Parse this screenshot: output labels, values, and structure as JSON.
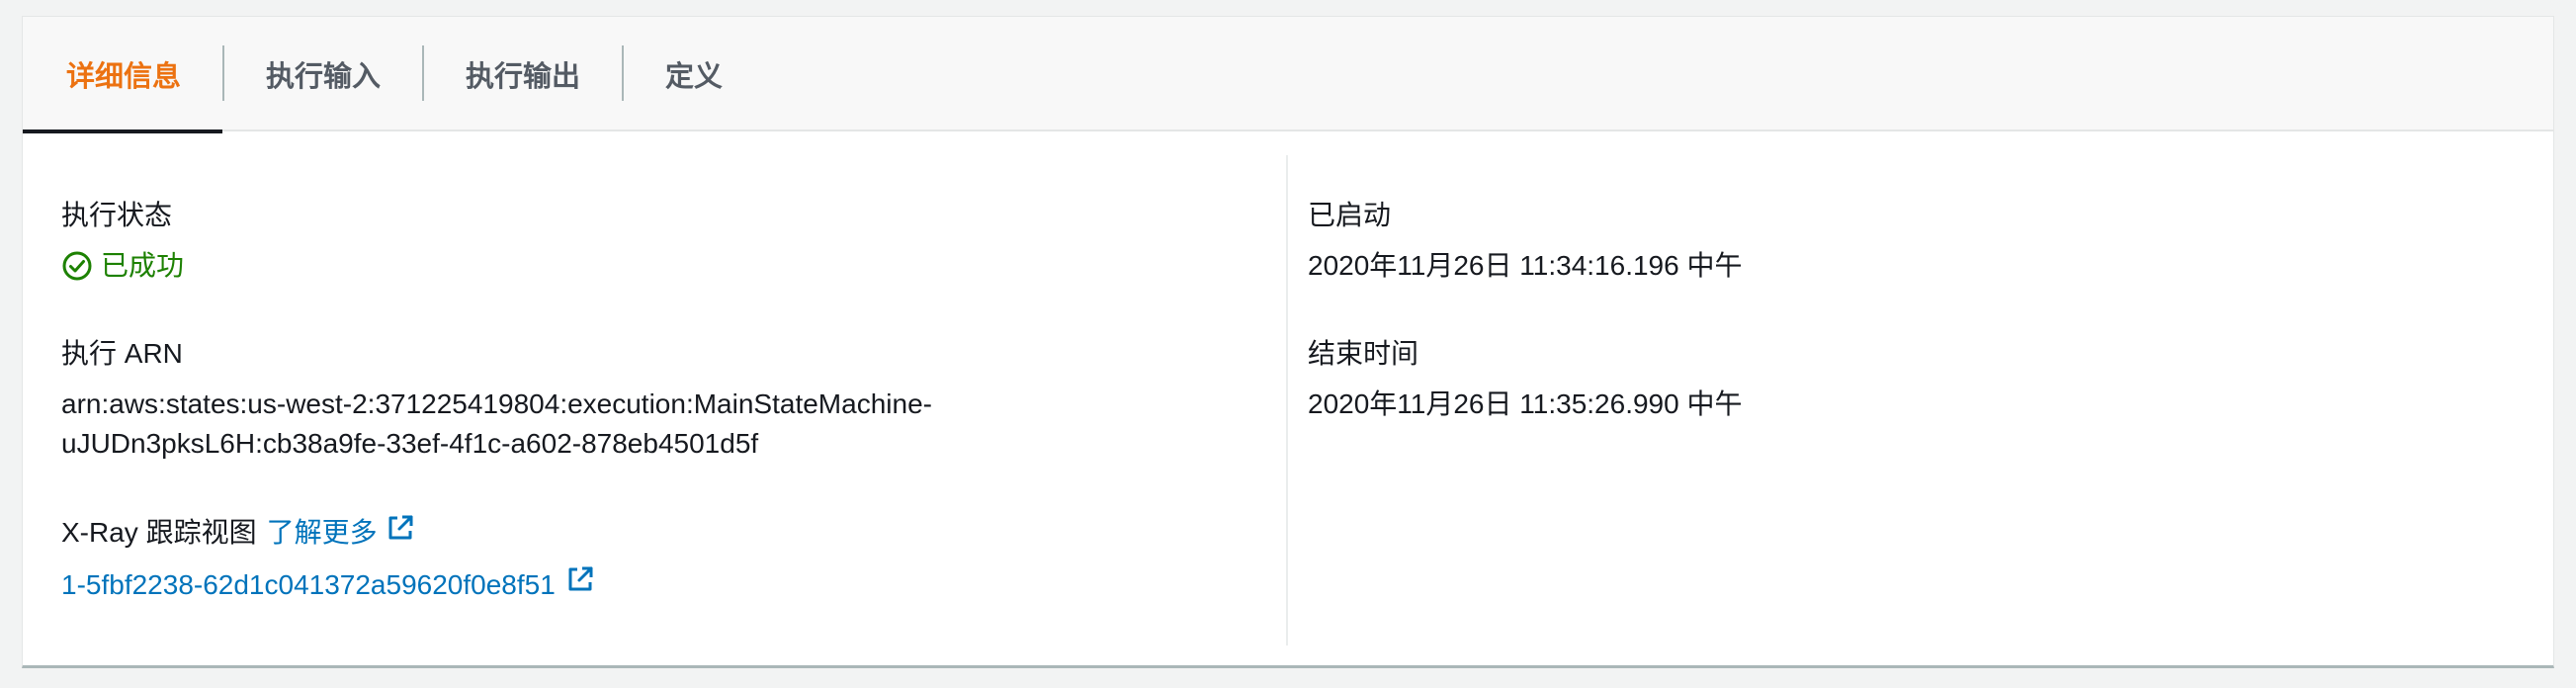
{
  "tabs": [
    {
      "label": "详细信息",
      "active": true
    },
    {
      "label": "执行输入",
      "active": false
    },
    {
      "label": "执行输出",
      "active": false
    },
    {
      "label": "定义",
      "active": false
    }
  ],
  "details": {
    "status": {
      "label": "执行状态",
      "value": "已成功",
      "icon": "check-circle-icon"
    },
    "arn": {
      "label": "执行 ARN",
      "line1": "arn:aws:states:us-west-2:371225419804:execution:MainStateMachine-",
      "line2": "uJUDn3pksL6H:cb38a9fe-33ef-4f1c-a602-878eb4501d5f"
    },
    "xray": {
      "label": "X-Ray 跟踪视图",
      "learn_more": "了解更多",
      "trace_id": "1-5fbf2238-62d1c041372a59620f0e8f51",
      "icon": "external-link-icon"
    },
    "started": {
      "label": "已启动",
      "value": "2020年11月26日 11:34:16.196 中午"
    },
    "ended": {
      "label": "结束时间",
      "value": "2020年11月26日 11:35:26.990 中午"
    }
  },
  "colors": {
    "active_tab": "#ec7211",
    "success": "#1d8102",
    "link": "#0073bb"
  }
}
